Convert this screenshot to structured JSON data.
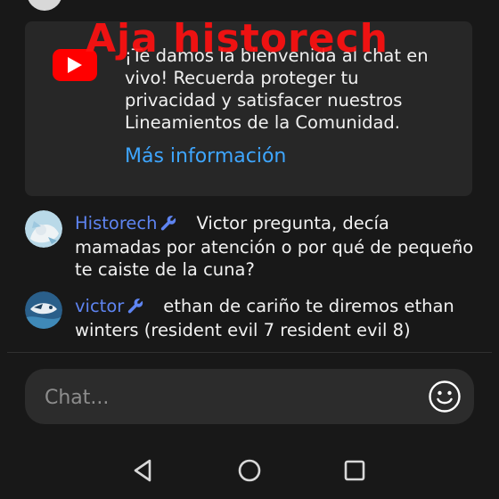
{
  "top_message": {
    "text": "— — — — — — · · ·"
  },
  "welcome_card": {
    "logo_icon": "youtube-logo-icon",
    "message": "¡Te damos la bienvenida al chat en vivo! Recuerda proteger tu privacidad y satisfacer nuestros Lineamientos de la Comunidad.",
    "more_info_link": "Más información"
  },
  "watermark": {
    "text": "Aja historech"
  },
  "messages": [
    {
      "author": "Historech",
      "moderator_icon": "wrench-icon",
      "text": "Victor pregunta, decía mamadas por atención o por qué de pequeño te caiste de la cuna?"
    },
    {
      "author": "victor",
      "moderator_icon": "wrench-icon",
      "text": "ethan de cariño te diremos ethan winters (resident evil 7 resident evil 8)"
    }
  ],
  "chat_input": {
    "placeholder": "Chat...",
    "value": "",
    "emoji_icon": "smiley-face-icon"
  },
  "nav_bar": {
    "back_icon": "triangle-back-icon",
    "home_icon": "circle-home-icon",
    "recents_icon": "square-recents-icon"
  },
  "colors": {
    "background": "#181818",
    "card": "#272727",
    "link": "#3ea6ff",
    "author": "#5e84f1",
    "youtube_red": "#ff0000",
    "watermark": "#ff1010"
  }
}
